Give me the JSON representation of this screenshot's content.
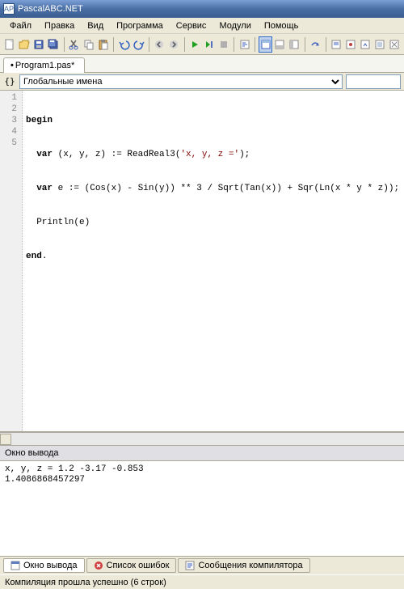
{
  "window": {
    "title": "PascalABC.NET"
  },
  "menu": {
    "file": "Файл",
    "edit": "Правка",
    "view": "Вид",
    "program": "Программа",
    "service": "Сервис",
    "modules": "Модули",
    "help": "Помощь"
  },
  "tabs": {
    "current": "Program1.pas*",
    "modified_marker": "•"
  },
  "scope": {
    "dropdown": "Глобальные имена"
  },
  "code": {
    "lines": [
      "begin",
      "  var (x, y, z) := ReadReal3('x, y, z =');",
      "  var e := (Cos(x) - Sin(y)) ** 3 / Sqrt(Tan(x)) + Sqr(Ln(x * y * z));",
      "  Println(e)",
      "end."
    ],
    "line_nums": [
      "1",
      "2",
      "3",
      "4",
      "5"
    ]
  },
  "output": {
    "header": "Окно вывода",
    "line1": "x, y, z = 1.2 -3.17 -0.853",
    "line2": "1.4086868457297"
  },
  "bottom_tabs": {
    "output": "Окно вывода",
    "errors": "Список ошибок",
    "compiler": "Сообщения компилятора"
  },
  "status": {
    "text": "Компиляция прошла успешно (6 строк)"
  }
}
